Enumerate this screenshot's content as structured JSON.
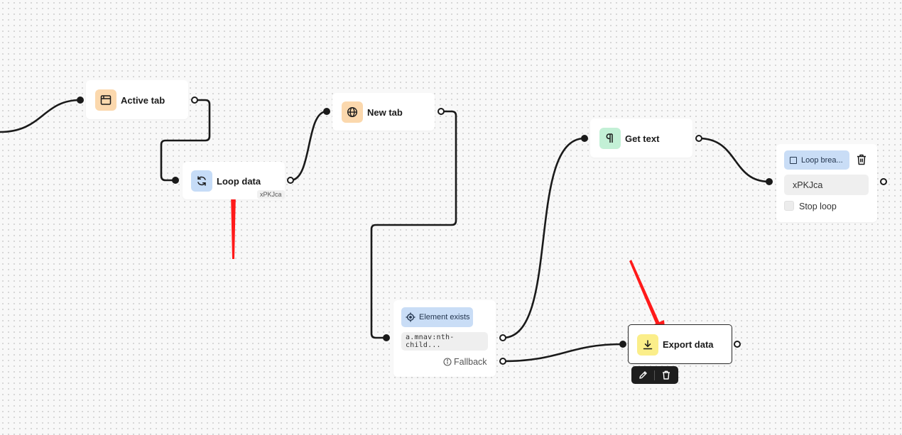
{
  "nodes": {
    "active_tab": {
      "label": "Active tab",
      "icon": "browser-window-icon",
      "icon_bg": "#fbd8ad"
    },
    "loop_data": {
      "label": "Loop data",
      "id_tag": "xPKJca",
      "icon": "loop-arrows-icon",
      "icon_bg": "#c6dcf7"
    },
    "new_tab": {
      "label": "New tab",
      "icon": "globe-icon",
      "icon_bg": "#fbd8ad"
    },
    "get_text": {
      "label": "Get text",
      "icon": "paragraph-icon",
      "icon_bg": "#c3f0d6"
    },
    "loop_breakpoint": {
      "title": "Loop brea...",
      "loop_id": "xPKJca",
      "stop_loop_label": "Stop loop",
      "stop_loop_checked": false,
      "icon": "stop-square-icon",
      "delete_icon": "trash-icon"
    },
    "element_exists": {
      "title": "Element exists",
      "selector": "a.mnav:nth-child...",
      "fallback_label": "Fallback",
      "icon": "crosshair-icon",
      "fallback_icon": "info-icon"
    },
    "export_data": {
      "label": "Export data",
      "icon": "download-icon",
      "icon_bg": "#fbee8a",
      "toolbar": {
        "edit_icon": "pencil-icon",
        "delete_icon": "trash-icon"
      }
    }
  },
  "colors": {
    "wire": "#1a1a1a",
    "annotation_arrow": "#ff1a1a",
    "canvas": "#f8f8f8"
  }
}
